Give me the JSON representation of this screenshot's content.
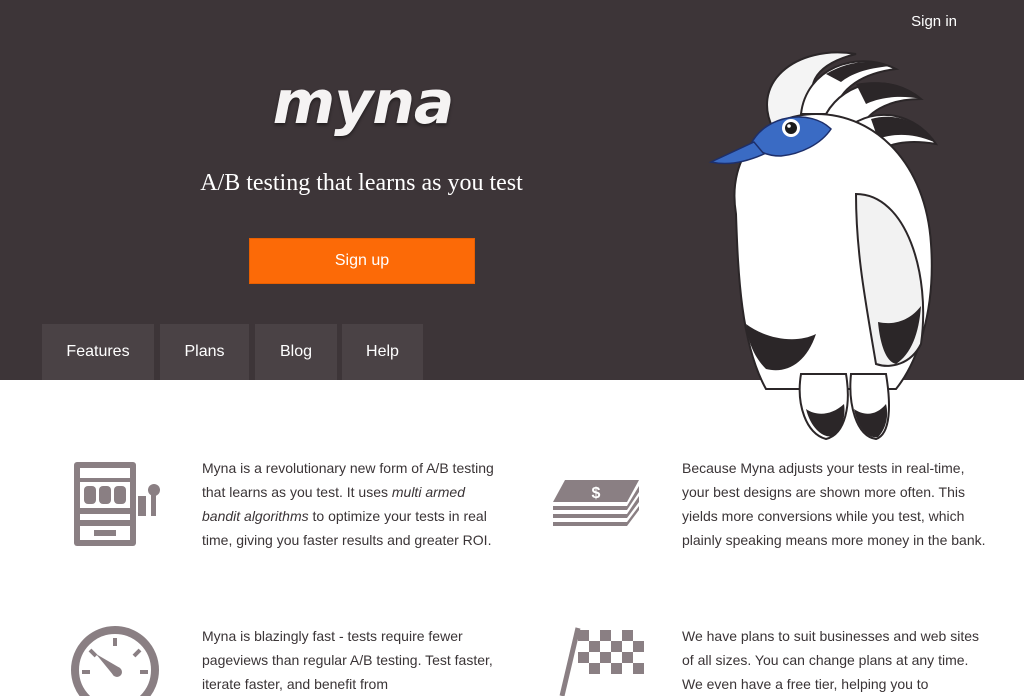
{
  "header": {
    "signin_label": "Sign in",
    "logo_text": "myna",
    "tagline": "A/B testing that learns as you test",
    "signup_label": "Sign up"
  },
  "nav": {
    "tabs": [
      {
        "label": "Features"
      },
      {
        "label": "Plans"
      },
      {
        "label": "Blog"
      },
      {
        "label": "Help"
      }
    ]
  },
  "features": [
    {
      "icon": "slot-machine-icon",
      "text_before": "Myna is a revolutionary new form of A/B testing that learns as you test. It uses ",
      "text_em": "multi armed bandit algorithms",
      "text_after": " to optimize your tests in real time, giving you faster results and greater ROI."
    },
    {
      "icon": "money-stack-icon",
      "text": "Because Myna adjusts your tests in real-time, your best designs are shown more often. This yields more conversions while you test, which plainly speaking means more money in the bank."
    },
    {
      "icon": "speedometer-icon",
      "text": "Myna is blazingly fast - tests require fewer pageviews than regular A/B testing. Test faster, iterate faster, and benefit from"
    },
    {
      "icon": "checkered-flag-icon",
      "text": "We have plans to suit businesses and web sites of all sizes. You can change plans at any time. We even have a free tier, helping you to"
    }
  ],
  "colors": {
    "hero_bg": "#3d3538",
    "tab_bg": "#4a4245",
    "accent": "#fc6a07",
    "icon": "#8a7f83",
    "bird_blue": "#3a6bc4"
  }
}
